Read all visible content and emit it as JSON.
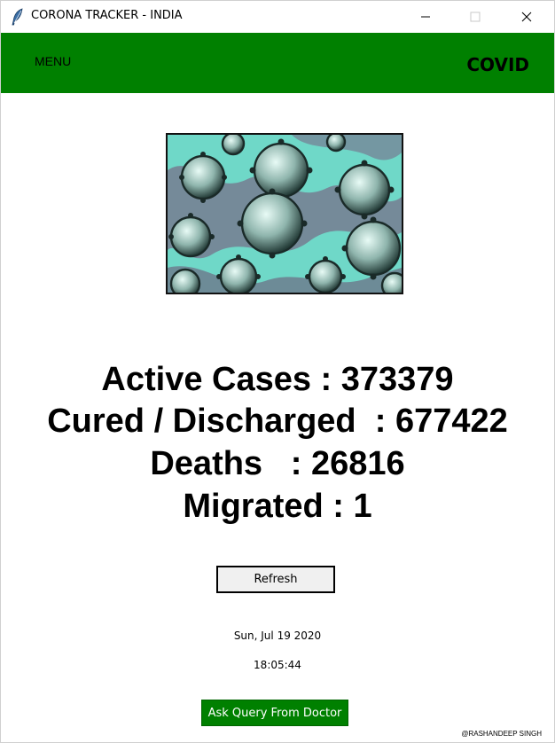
{
  "window": {
    "title": "CORONA TRACKER - INDIA",
    "app_icon": "feather-icon",
    "controls": [
      "minimize-icon",
      "maximize-icon",
      "close-icon"
    ]
  },
  "header": {
    "background": "#008000",
    "menu_label": "MENU",
    "brand_label": "COVID"
  },
  "main": {
    "image_subject": "coronavirus-illustration",
    "stats": {
      "active": "Active Cases : 373379",
      "cured": "Cured / Discharged  : 677422",
      "deaths": "Deaths   : 26816",
      "migrated": "Migrated : 1"
    },
    "refresh_label": "Refresh",
    "date": "Sun, Jul 19 2020",
    "time": "18:05:44",
    "ask_label": "Ask Query From Doctor",
    "ask_color": "#008000"
  },
  "footer": {
    "credit": "@RASHANDEEP SINGH"
  }
}
